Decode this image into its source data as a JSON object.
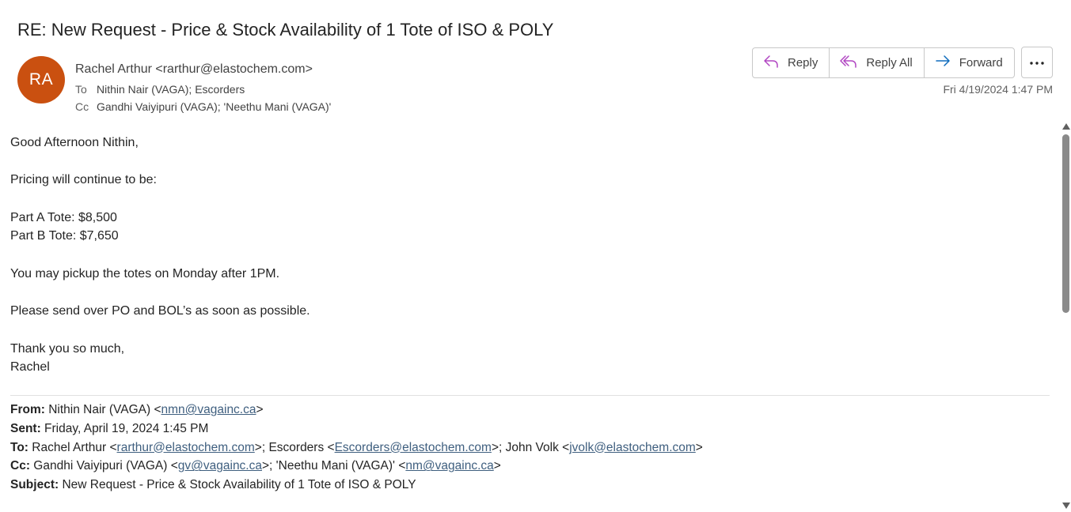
{
  "email": {
    "subject": "RE: New Request - Price & Stock Availability of 1 Tote of ISO & POLY",
    "avatar_initials": "RA",
    "avatar_color": "#ca5010",
    "sender": "Rachel Arthur <rarthur@elastochem.com>",
    "to_label": "To",
    "to": "Nithin Nair (VAGA); Escorders",
    "cc_label": "Cc",
    "cc": "Gandhi Vaiyipuri (VAGA); 'Neethu Mani (VAGA)'",
    "date": "Fri 4/19/2024 1:47 PM"
  },
  "actions": {
    "reply": "Reply",
    "reply_all": "Reply All",
    "forward": "Forward",
    "more_icon": "ellipsis-icon",
    "accent_color": "#b146c2",
    "forward_color": "#0f6cbd"
  },
  "body": {
    "greeting": "Good Afternoon Nithin,",
    "line1": "Pricing will continue to be:",
    "part_a": "Part A Tote: $8,500",
    "part_b": "Part B Tote: $7,650",
    "pickup": "You may pickup the totes on Monday after 1PM.",
    "request": "Please send over PO and BOL’s as soon as possible.",
    "thanks": "Thank you so much,",
    "signature": "Rachel"
  },
  "quoted": {
    "from_label": "From:",
    "from_name": " Nithin Nair (VAGA) <",
    "from_email": "nmn@vagainc.ca",
    "from_close": ">",
    "sent_label": "Sent:",
    "sent_value": " Friday, April 19, 2024 1:45 PM",
    "to_label": "To:",
    "to_part1": " Rachel Arthur <",
    "to_email1": "rarthur@elastochem.com",
    "to_part2": ">; Escorders <",
    "to_email2": "Escorders@elastochem.com",
    "to_part3": ">; John Volk <",
    "to_email3": "jvolk@elastochem.com",
    "to_part4": ">",
    "cc_label": "Cc:",
    "cc_part1": " Gandhi Vaiyipuri (VAGA) <",
    "cc_email1": "gv@vagainc.ca",
    "cc_part2": ">; 'Neethu Mani (VAGA)' <",
    "cc_email2": "nm@vagainc.ca",
    "cc_part3": ">",
    "subject_label": "Subject:",
    "subject_value": " New Request - Price & Stock Availability of 1 Tote of ISO & POLY"
  }
}
